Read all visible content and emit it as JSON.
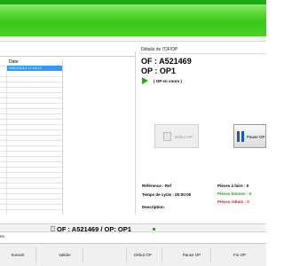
{
  "grid": {
    "header_date": "Date",
    "selected_row_value": "03/07/2013 17:13:12"
  },
  "details": {
    "title": "Détails de l'OF/OP",
    "of": "OF : A521469",
    "op": "OP : OP1",
    "status": "( OP en cours )",
    "debut_button": "Début OP",
    "pause_button": "Pause OP",
    "reference": "Référence : Ref",
    "cycle_time": "Temps de cycle : 00:00:00",
    "description": "Description",
    "pieces_a_faire": "Pièces à faire : 0",
    "pieces_bonnes": "Pièces bonnes : 0",
    "pieces_rebuts": "Pièces rebuts : 0"
  },
  "info_bar": {
    "current": "OF : A521469 / OP: OP1"
  },
  "left_label": "ns",
  "toolbar": {
    "suivant": "Suivant",
    "valider": "Valider",
    "debut_op": "Début OP",
    "pause_op": "Pause OP",
    "fin_op": "Fin OP"
  },
  "colors": {
    "banner_green": "#3cc81c",
    "selection_blue": "#3399ff",
    "pieces_bonnes": "#1a9a1a",
    "pieces_rebuts": "#c82020",
    "pause_icon_blue": "#1e56b8"
  }
}
